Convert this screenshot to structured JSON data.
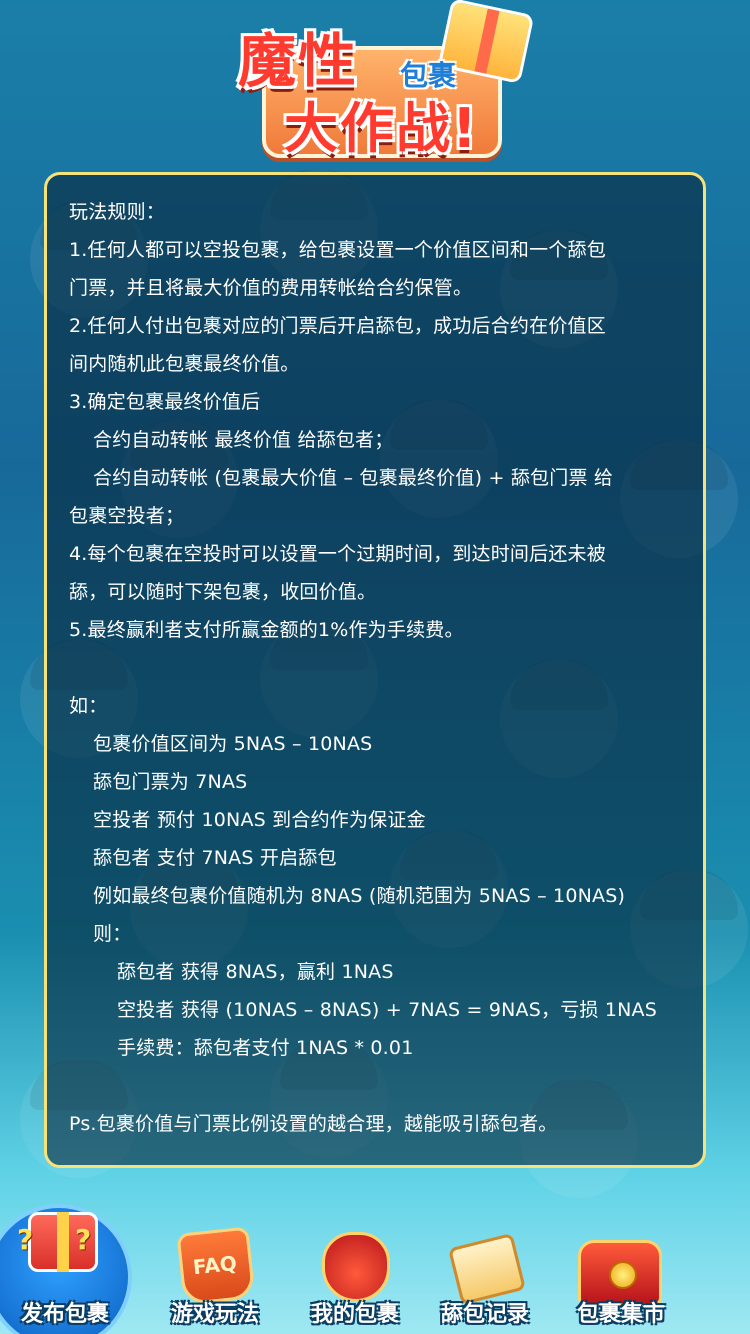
{
  "header": {
    "title_main": "魔性",
    "title_sub": "包裹",
    "title_second": "大作战!"
  },
  "rules": {
    "lines": [
      {
        "text": "玩法规则：",
        "indent": 0
      },
      {
        "text": "1.任何人都可以空投包裹，给包裹设置一个价值区间和一个舔包",
        "indent": 0
      },
      {
        "text": "门票，并且将最大价值的费用转帐给合约保管。",
        "indent": 0
      },
      {
        "text": "2.任何人付出包裹对应的门票后开启舔包，成功后合约在价值区",
        "indent": 0
      },
      {
        "text": "间内随机此包裹最终价值。",
        "indent": 0
      },
      {
        "text": "3.确定包裹最终价值后",
        "indent": 0
      },
      {
        "text": "合约自动转帐 最终价值 给舔包者；",
        "indent": 1
      },
      {
        "text": "合约自动转帐 (包裹最大价值 – 包裹最终价值) + 舔包门票 给",
        "indent": 1
      },
      {
        "text": "包裹空投者；",
        "indent": 0
      },
      {
        "text": "4.每个包裹在空投时可以设置一个过期时间，到达时间后还未被",
        "indent": 0
      },
      {
        "text": "舔，可以随时下架包裹，收回价值。",
        "indent": 0
      },
      {
        "text": "5.最终赢利者支付所赢金额的1%作为手续费。",
        "indent": 0
      },
      {
        "text": "",
        "indent": 0
      },
      {
        "text": "如：",
        "indent": 0
      },
      {
        "text": "包裹价值区间为 5NAS – 10NAS",
        "indent": 1
      },
      {
        "text": "舔包门票为 7NAS",
        "indent": 1
      },
      {
        "text": "空投者 预付 10NAS 到合约作为保证金",
        "indent": 1
      },
      {
        "text": "舔包者 支付 7NAS 开启舔包",
        "indent": 1
      },
      {
        "text": "例如最终包裹价值随机为 8NAS (随机范围为 5NAS – 10NAS)",
        "indent": 1
      },
      {
        "text": "则：",
        "indent": 1
      },
      {
        "text": "舔包者 获得 8NAS，赢利 1NAS",
        "indent": 2
      },
      {
        "text": "空投者 获得 (10NAS – 8NAS) + 7NAS = 9NAS，亏损 1NAS",
        "indent": 2
      },
      {
        "text": "手续费：舔包者支付 1NAS * 0.01",
        "indent": 2
      },
      {
        "text": "",
        "indent": 0
      },
      {
        "text": "Ps.包裹价值与门票比例设置的越合理，越能吸引舔包者。",
        "indent": 0
      }
    ]
  },
  "nav": {
    "items": [
      {
        "label": "发布包裹",
        "icon": "gift-question-icon"
      },
      {
        "label": "游戏玩法",
        "icon": "faq-flag-icon"
      },
      {
        "label": "我的包裹",
        "icon": "lucky-bag-icon"
      },
      {
        "label": "舔包记录",
        "icon": "scroll-icon"
      },
      {
        "label": "包裹集市",
        "icon": "treasure-chest-icon"
      }
    ]
  },
  "colors": {
    "panel_border": "#f6e27a",
    "background_top": "#1a7fa8",
    "background_bottom": "#9fe8f2",
    "title_red": "#ff3b2f"
  }
}
